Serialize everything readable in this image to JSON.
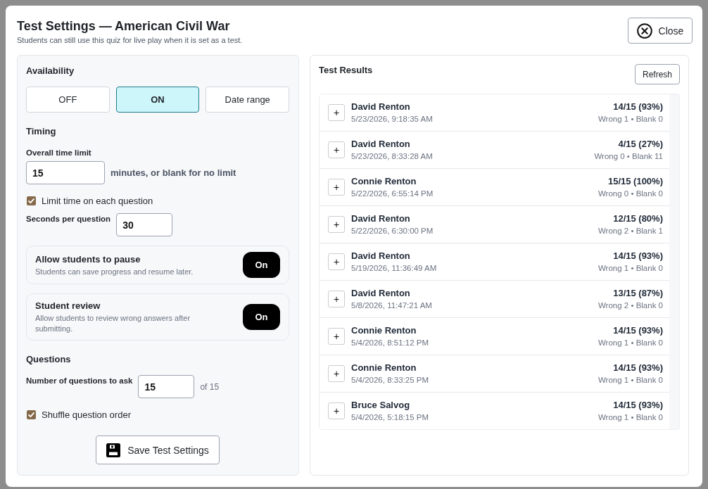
{
  "dialog": {
    "title": "Test Settings — American Civil War",
    "subtitle": "Students can still use this quiz for live play when it is set as a test.",
    "close_button": "Close"
  },
  "settings": {
    "availability": {
      "heading": "Availability",
      "options": [
        {
          "label": "OFF",
          "selected": false
        },
        {
          "label": "ON",
          "selected": true
        },
        {
          "label": "Date range",
          "selected": false
        }
      ]
    },
    "timing": {
      "heading": "Timing",
      "overall_time_limit": {
        "label": "Overall time limit",
        "value": "15",
        "hint": "minutes, or blank for no limit"
      },
      "limit_each_question": {
        "label": "Limit time on each question",
        "checked": true
      },
      "seconds_per_question": {
        "label": "Seconds per question",
        "value": "30"
      }
    },
    "toggles": [
      {
        "title": "Allow students to pause",
        "description": "Students can save progress and resume later.",
        "on": true,
        "state_label": "On"
      },
      {
        "title": "Student review",
        "description": "Allow students to review wrong answers after submitting.",
        "on": true,
        "state_label": "On"
      }
    ],
    "questions": {
      "heading": "Questions",
      "count": {
        "label": "Number of questions to ask",
        "value": "15",
        "suffix": "of 15"
      },
      "shuffle": {
        "label": "Shuffle question order",
        "checked": true
      }
    },
    "save_button": "Save Test Settings"
  },
  "results": {
    "heading": "Test Results",
    "refresh_button": "Refresh",
    "rows": [
      {
        "expand": "+",
        "name": "David Renton",
        "date": "5/23/2026, 9:18:35 AM",
        "score": "14/15 (93%)",
        "detail": "Wrong 1 • Blank 0"
      },
      {
        "expand": "+",
        "name": "David Renton",
        "date": "5/23/2026, 8:33:28 AM",
        "score": "4/15 (27%)",
        "detail": "Wrong 0 • Blank 11"
      },
      {
        "expand": "+",
        "name": "Connie Renton",
        "date": "5/22/2026, 6:55:14 PM",
        "score": "15/15 (100%)",
        "detail": "Wrong 0 • Blank 0"
      },
      {
        "expand": "+",
        "name": "David Renton",
        "date": "5/22/2026, 6:30:00 PM",
        "score": "12/15 (80%)",
        "detail": "Wrong 2 • Blank 1"
      },
      {
        "expand": "+",
        "name": "David Renton",
        "date": "5/19/2026, 11:36:49 AM",
        "score": "14/15 (93%)",
        "detail": "Wrong 1 • Blank 0"
      },
      {
        "expand": "+",
        "name": "David Renton",
        "date": "5/8/2026, 11:47:21 AM",
        "score": "13/15 (87%)",
        "detail": "Wrong 2 • Blank 0"
      },
      {
        "expand": "+",
        "name": "Connie Renton",
        "date": "5/4/2026, 8:51:12 PM",
        "score": "14/15 (93%)",
        "detail": "Wrong 1 • Blank 0"
      },
      {
        "expand": "+",
        "name": "Connie Renton",
        "date": "5/4/2026, 8:33:25 PM",
        "score": "14/15 (93%)",
        "detail": "Wrong 1 • Blank 0"
      },
      {
        "expand": "+",
        "name": "Bruce Salvog",
        "date": "5/4/2026, 5:18:15 PM",
        "score": "14/15 (93%)",
        "detail": "Wrong 1 • Blank 0"
      }
    ]
  }
}
